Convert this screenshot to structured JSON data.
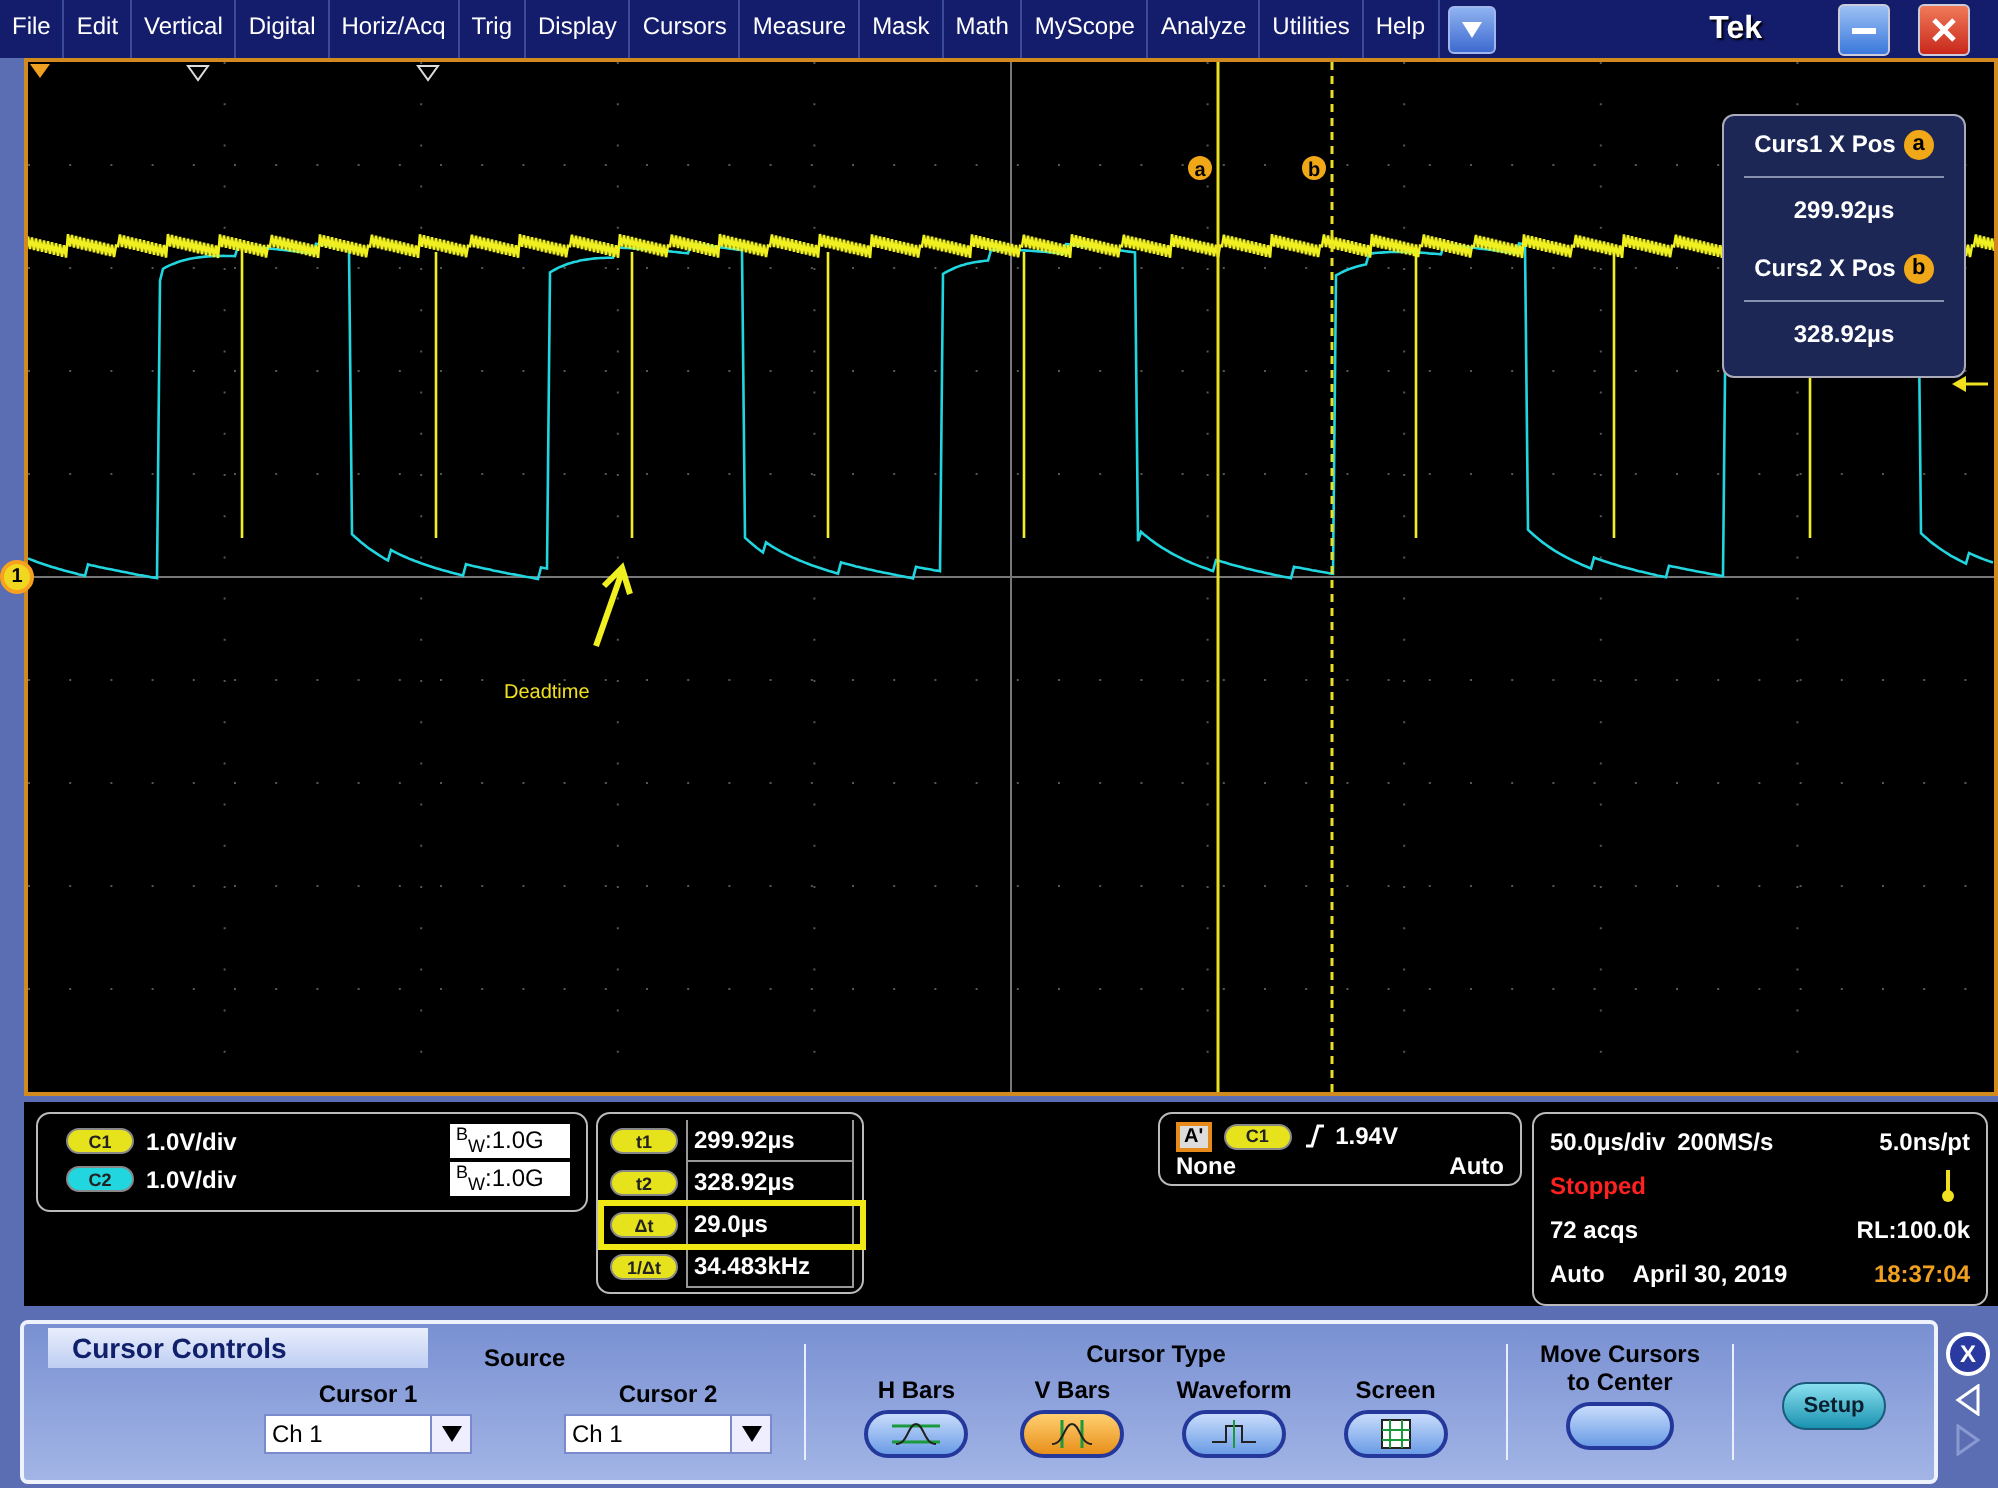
{
  "menu": [
    {
      "label": "File"
    },
    {
      "label": "Edit"
    },
    {
      "label": "Vertical"
    },
    {
      "label": "Digital"
    },
    {
      "label": "Horiz/Acq"
    },
    {
      "label": "Trig"
    },
    {
      "label": "Display"
    },
    {
      "label": "Cursors"
    },
    {
      "label": "Measure"
    },
    {
      "label": "Mask"
    },
    {
      "label": "Math"
    },
    {
      "label": "MyScope"
    },
    {
      "label": "Analyze"
    },
    {
      "label": "Utilities"
    },
    {
      "label": "Help"
    }
  ],
  "window": {
    "logo": "Tek"
  },
  "graticule": {
    "channel_marker": "1",
    "cursor_markers": [
      "a",
      "b"
    ],
    "annotation": "Deadtime",
    "cursor_readout": [
      {
        "label": "Curs1 X Pos",
        "badge": "a",
        "value": "299.92µs"
      },
      {
        "label": "Curs2 X Pos",
        "badge": "b",
        "value": "328.92µs"
      }
    ]
  },
  "channels": [
    {
      "label": "C1",
      "scale": "1.0V/div",
      "bandwidth": "$^{B}$$_{W}$:1.0G",
      "color": "#e6e21c"
    },
    {
      "label": "C2",
      "scale": "1.0V/div",
      "bandwidth": "$^{B}$$_{W}$:1.0G",
      "color": "#22d6e0"
    }
  ],
  "cursor_values": [
    {
      "label": "t1",
      "value": "299.92µs",
      "highlighted": false
    },
    {
      "label": "t2",
      "value": "328.92µs",
      "highlighted": false
    },
    {
      "label": "Δt",
      "value": "29.0µs",
      "highlighted": true
    },
    {
      "label": "1/Δt",
      "value": "34.483kHz",
      "highlighted": false
    }
  ],
  "trigger": {
    "marker": "A'",
    "source": "C1",
    "level": "1.94V",
    "coupling": "None",
    "mode": "Auto"
  },
  "acquisition": {
    "timebase": "50.0µs/div",
    "sample_rate": "200MS/s",
    "resolution": "5.0ns/pt",
    "status": "Stopped",
    "acqs": "72 acqs",
    "record_length": "RL:100.0k",
    "mode": "Auto",
    "date": "April 30, 2019",
    "time": "18:37:04"
  },
  "cursor_controls": {
    "title": "Cursor Controls",
    "source_title": "Source",
    "sources": [
      {
        "label": "Cursor 1",
        "value": "Ch 1"
      },
      {
        "label": "Cursor 2",
        "value": "Ch 1"
      }
    ],
    "type_title": "Cursor Type",
    "types": [
      {
        "label": "H Bars",
        "kind": "hbars",
        "selected": false
      },
      {
        "label": "V Bars",
        "kind": "vbars",
        "selected": true
      },
      {
        "label": "Waveform",
        "kind": "waveform",
        "selected": false
      },
      {
        "label": "Screen",
        "kind": "screen",
        "selected": false
      }
    ],
    "move_title": "Move Cursors to Center",
    "setup": "Setup",
    "close": "X"
  }
}
